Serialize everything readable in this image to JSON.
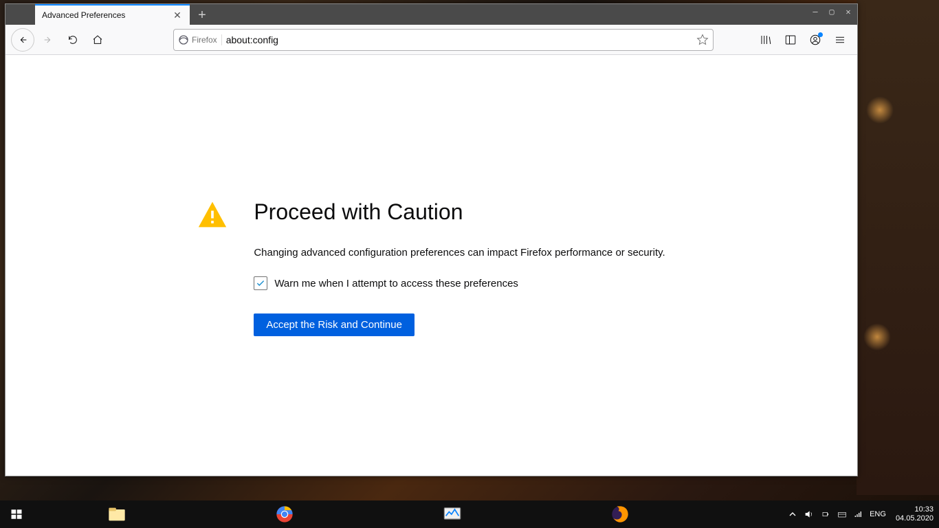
{
  "browser": {
    "tab_title": "Advanced Preferences",
    "url_identity_label": "Firefox",
    "url_value": "about:config"
  },
  "content": {
    "heading": "Proceed with Caution",
    "description": "Changing advanced configuration preferences can impact Firefox performance or security.",
    "checkbox_label": "Warn me when I attempt to access these preferences",
    "checkbox_checked": true,
    "accept_button": "Accept the Risk and Continue"
  },
  "taskbar": {
    "lang": "ENG",
    "time": "10:33",
    "date": "04.05.2020"
  },
  "colors": {
    "accent": "#0060df",
    "link_blue": "#0a84ff",
    "warn_yellow": "#ffbf00"
  }
}
